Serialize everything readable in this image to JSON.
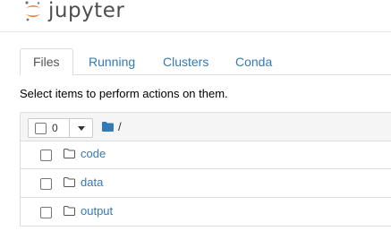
{
  "app": {
    "logo_text": "jupyter"
  },
  "tabs": [
    {
      "label": "Files"
    },
    {
      "label": "Running"
    },
    {
      "label": "Clusters"
    },
    {
      "label": "Conda"
    }
  ],
  "instructions": "Select items to perform actions on them.",
  "list_header": {
    "selected_count": "0",
    "breadcrumb_sep": "/"
  },
  "items": [
    {
      "name": "code"
    },
    {
      "name": "data"
    },
    {
      "name": "output"
    }
  ],
  "colors": {
    "link": "#337ab7",
    "logo_orange": "#f37726",
    "folder_blue": "#337ab7"
  }
}
